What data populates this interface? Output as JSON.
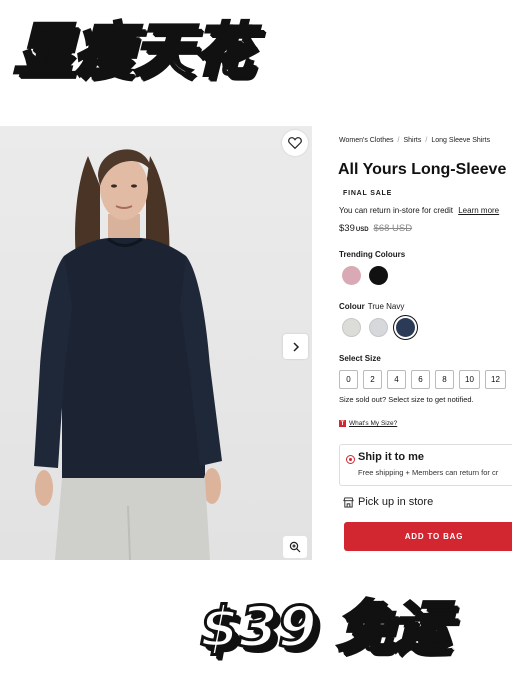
{
  "banner": {
    "top_text": "显瘦天花",
    "bottom_text": "$39 免运"
  },
  "breadcrumb": [
    "Women's Clothes",
    "Shirts",
    "Long Sleeve Shirts"
  ],
  "product": {
    "title": "All Yours Long-Sleeve",
    "final_sale": "FINAL SALE",
    "return_note": "You can return in-store for credit",
    "learn_more": "Learn more",
    "price": "$39",
    "currency": "USD",
    "old_price": "$68 USD"
  },
  "trending": {
    "label": "Trending Colours",
    "swatches": [
      {
        "name": "pink",
        "color": "#d9a9b5"
      },
      {
        "name": "black",
        "color": "#111111"
      }
    ]
  },
  "colour": {
    "label": "Colour",
    "value": "True Navy",
    "swatches": [
      {
        "name": "light-grey",
        "color": "#dcdcd8"
      },
      {
        "name": "grey",
        "color": "#d6d8dc"
      },
      {
        "name": "true-navy",
        "color": "#2a3a57",
        "selected": true
      }
    ]
  },
  "sizes": {
    "label": "Select Size",
    "options": [
      "0",
      "2",
      "4",
      "6",
      "8",
      "10",
      "12"
    ],
    "sold_out_note": "Size sold out? Select size to get notified.",
    "guide_link": "What's My Size?"
  },
  "shipping": {
    "ship_title": "Ship it to me",
    "ship_sub": "Free shipping + Members can return for cr",
    "pickup": "Pick up in store"
  },
  "cta": {
    "add_to_bag": "ADD TO BAG"
  },
  "colors": {
    "accent": "#d22630",
    "shirt": "#1c2433"
  },
  "icons": {
    "wishlist": "heart-icon",
    "next": "chevron-right-icon",
    "zoom": "zoom-in-icon",
    "store": "store-icon"
  }
}
